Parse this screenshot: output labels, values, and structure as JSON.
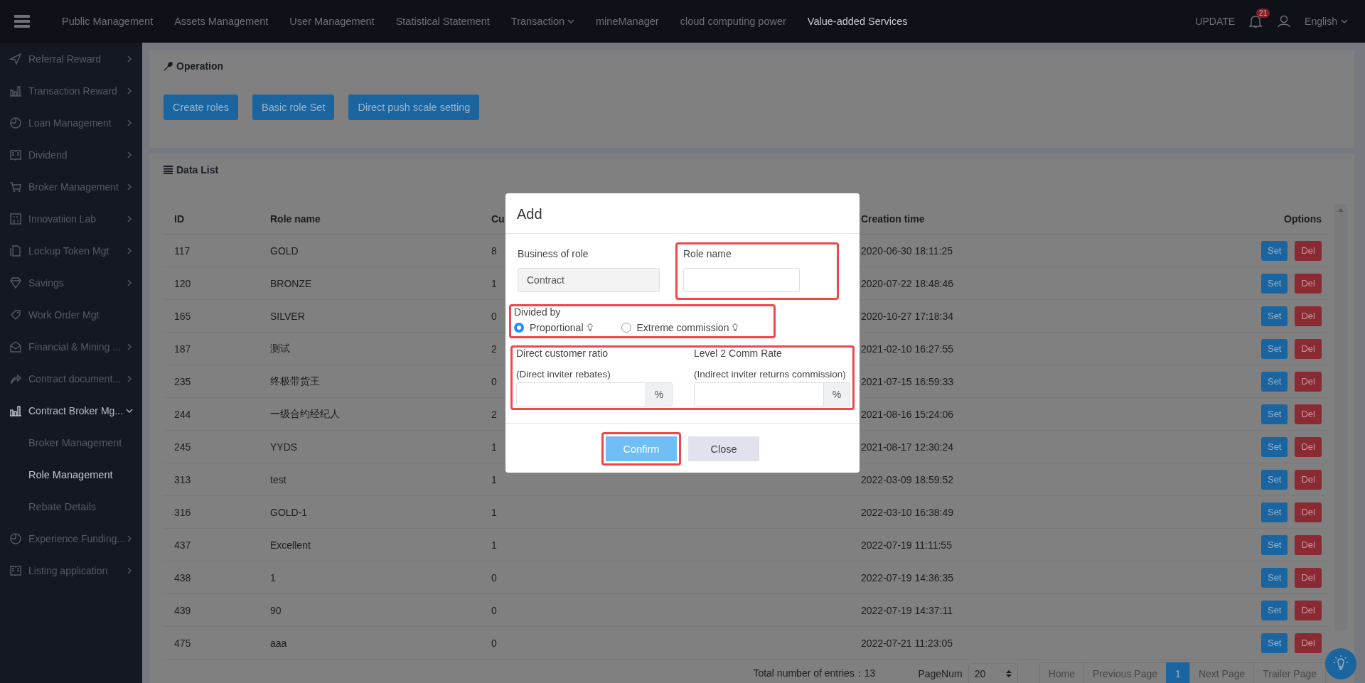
{
  "topbar": {
    "nav": [
      {
        "label": "Public Management",
        "selected": false,
        "dropdown": false
      },
      {
        "label": "Assets Management",
        "selected": false,
        "dropdown": false
      },
      {
        "label": "User Management",
        "selected": false,
        "dropdown": false
      },
      {
        "label": "Statistical Statement",
        "selected": false,
        "dropdown": false
      },
      {
        "label": "Transaction",
        "selected": false,
        "dropdown": true
      },
      {
        "label": "mineManager",
        "selected": false,
        "dropdown": false
      },
      {
        "label": "cloud computing power",
        "selected": false,
        "dropdown": false
      },
      {
        "label": "Value-added Services",
        "selected": true,
        "dropdown": false
      }
    ],
    "update": "UPDATE",
    "notifications": "21",
    "language": "English"
  },
  "sidebar": {
    "items": [
      {
        "label": "Referral Reward",
        "expandable": true,
        "expanded": false
      },
      {
        "label": "Transaction Reward",
        "expandable": true,
        "expanded": false
      },
      {
        "label": "Loan Management",
        "expandable": true,
        "expanded": false
      },
      {
        "label": "Dividend",
        "expandable": true,
        "expanded": false
      },
      {
        "label": "Broker Management",
        "expandable": true,
        "expanded": false
      },
      {
        "label": "Innovatiion Lab",
        "expandable": true,
        "expanded": false
      },
      {
        "label": "Lockup Token Mgt",
        "expandable": true,
        "expanded": false
      },
      {
        "label": "Savings",
        "expandable": true,
        "expanded": false
      },
      {
        "label": "Work Order Mgt",
        "expandable": false,
        "expanded": false
      },
      {
        "label": "Financial & Mining ...",
        "expandable": true,
        "expanded": false
      },
      {
        "label": "Contract document...",
        "expandable": true,
        "expanded": false
      },
      {
        "label": "Contract Broker Mg...",
        "expandable": true,
        "expanded": true,
        "children": [
          {
            "label": "Broker Management",
            "selected": false
          },
          {
            "label": "Role Management",
            "selected": true
          },
          {
            "label": "Rebate Details",
            "selected": false
          }
        ]
      },
      {
        "label": "Experience Funding...",
        "expandable": true,
        "expanded": false
      },
      {
        "label": "Listing application",
        "expandable": true,
        "expanded": false
      }
    ]
  },
  "operation": {
    "title": "Operation",
    "buttons": [
      "Create roles",
      "Basic role Set",
      "Direct push scale setting"
    ]
  },
  "data_list": {
    "title": "Data List",
    "table": {
      "columns": [
        "ID",
        "Role name",
        "Cu",
        "Creation time",
        "Options"
      ],
      "rows": [
        {
          "cells": [
            "117",
            "GOLD",
            "8",
            "2020-06-30 18:11:25"
          ],
          "actions": [
            {
              "label": "Set",
              "kind": "edit"
            },
            {
              "label": "Del",
              "kind": "delete"
            }
          ]
        },
        {
          "cells": [
            "120",
            "BRONZE",
            "1",
            "2020-07-22 18:48:46"
          ],
          "actions": [
            {
              "label": "Set",
              "kind": "edit"
            },
            {
              "label": "Del",
              "kind": "delete"
            }
          ]
        },
        {
          "cells": [
            "165",
            "SILVER",
            "0",
            "2020-10-27 17:18:34"
          ],
          "actions": [
            {
              "label": "Set",
              "kind": "edit"
            },
            {
              "label": "Del",
              "kind": "delete"
            }
          ]
        },
        {
          "cells": [
            "187",
            "测试",
            "2",
            "2021-02-10 16:27:55"
          ],
          "actions": [
            {
              "label": "Set",
              "kind": "edit"
            },
            {
              "label": "Del",
              "kind": "delete"
            }
          ]
        },
        {
          "cells": [
            "235",
            "终极带货王",
            "0",
            "2021-07-15 16:59:33"
          ],
          "actions": [
            {
              "label": "Set",
              "kind": "edit"
            },
            {
              "label": "Del",
              "kind": "delete"
            }
          ]
        },
        {
          "cells": [
            "244",
            "一级合约经纪人",
            "2",
            "2021-08-16 15:24:06"
          ],
          "actions": [
            {
              "label": "Set",
              "kind": "edit"
            },
            {
              "label": "Del",
              "kind": "delete"
            }
          ]
        },
        {
          "cells": [
            "245",
            "YYDS",
            "1",
            "2021-08-17 12:30:24"
          ],
          "actions": [
            {
              "label": "Set",
              "kind": "edit"
            },
            {
              "label": "Del",
              "kind": "delete"
            }
          ]
        },
        {
          "cells": [
            "313",
            "test",
            "1",
            "2022-03-09 18:59:52"
          ],
          "actions": [
            {
              "label": "Set",
              "kind": "edit"
            },
            {
              "label": "Del",
              "kind": "delete"
            }
          ]
        },
        {
          "cells": [
            "316",
            "GOLD-1",
            "1",
            "2022-03-10 16:38:49"
          ],
          "actions": [
            {
              "label": "Set",
              "kind": "edit"
            },
            {
              "label": "Del",
              "kind": "delete"
            }
          ]
        },
        {
          "cells": [
            "437",
            "Excellent",
            "1",
            "2022-07-19 11:11:55"
          ],
          "actions": [
            {
              "label": "Set",
              "kind": "edit"
            },
            {
              "label": "Del",
              "kind": "delete"
            }
          ]
        },
        {
          "cells": [
            "438",
            "1",
            "0",
            "2022-07-19 14:36:35"
          ],
          "actions": [
            {
              "label": "Set",
              "kind": "edit"
            },
            {
              "label": "Del",
              "kind": "delete"
            }
          ]
        },
        {
          "cells": [
            "439",
            "90",
            "0",
            "2022-07-19 14:37:11"
          ],
          "actions": [
            {
              "label": "Set",
              "kind": "edit"
            },
            {
              "label": "Del",
              "kind": "delete"
            }
          ]
        },
        {
          "cells": [
            "475",
            "aaa",
            "0",
            "2022-07-21 11:23:05"
          ],
          "actions": [
            {
              "label": "Set",
              "kind": "edit"
            },
            {
              "label": "Del",
              "kind": "delete"
            }
          ]
        }
      ]
    },
    "pagination": {
      "total": "Total number of entries：13",
      "page_size_label": "PageNum",
      "page_size": "20",
      "pages": [
        {
          "label": "Home",
          "selected": false
        },
        {
          "label": "Previous Page",
          "selected": false
        },
        {
          "label": "1",
          "selected": true
        },
        {
          "label": "Next Page",
          "selected": false
        },
        {
          "label": "Trailer Page",
          "selected": false
        }
      ]
    }
  },
  "dialog": {
    "title": "Add",
    "business": {
      "label": "Business of role",
      "value": "Contract"
    },
    "role_name": {
      "label": "Role name",
      "annotated": true
    },
    "divided_by": {
      "label": "Divided by",
      "annotated": true,
      "options": [
        {
          "label": "Proportional",
          "selected": true
        },
        {
          "label": "Extreme commission",
          "selected": false
        }
      ]
    },
    "ratios": {
      "annotated": true,
      "fields": [
        {
          "label": "Direct customer ratio",
          "hint": "(Direct inviter rebates)",
          "unit": "%"
        },
        {
          "label": "Level 2 Comm Rate",
          "hint": "(Indirect inviter returns commission)",
          "unit": "%"
        }
      ]
    },
    "buttons": [
      {
        "label": "Confirm",
        "kind": "primary",
        "annotated": true
      },
      {
        "label": "Close",
        "kind": "secondary",
        "annotated": false
      }
    ]
  }
}
